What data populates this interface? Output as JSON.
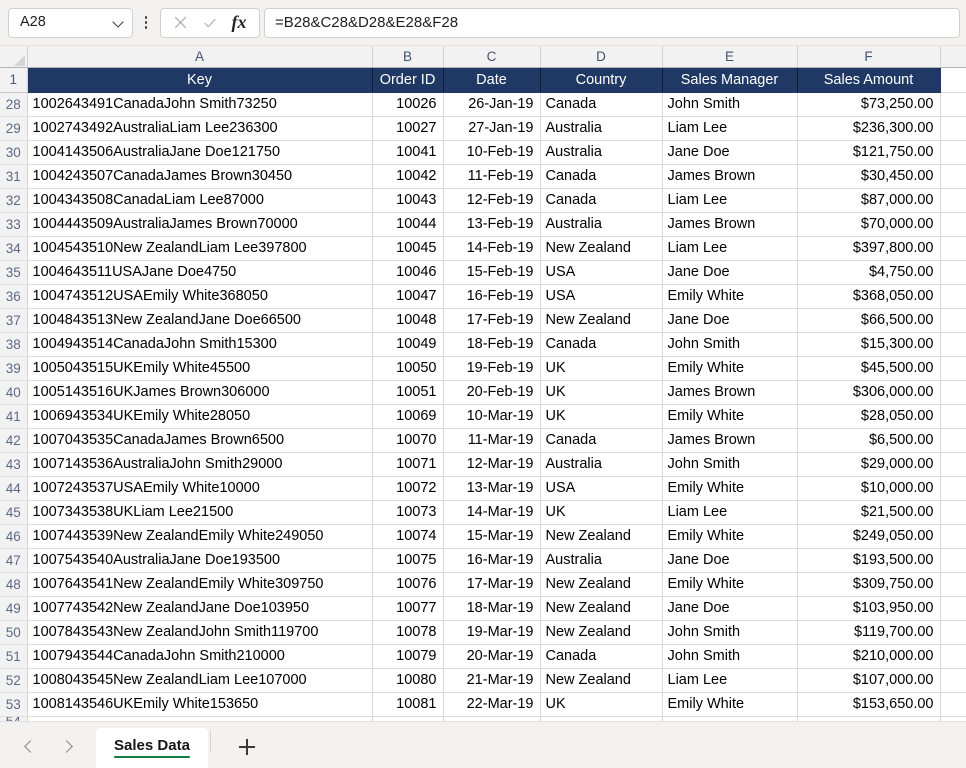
{
  "app": {
    "title": "Sales Data"
  },
  "formula_bar": {
    "name_box_value": "A28",
    "formula_value": "=B28&C28&D28&E28&F28",
    "cancel_label": "✕",
    "enter_label": "✓",
    "fx_label": "fx"
  },
  "grid": {
    "column_letters": [
      "A",
      "B",
      "C",
      "D",
      "E",
      "F",
      ""
    ],
    "header_row_number": "1",
    "headers": [
      "Key",
      "Order ID",
      "Date",
      "Country",
      "Sales Manager",
      "Sales Amount"
    ],
    "partial_row_number": "54",
    "rows": [
      {
        "n": "28",
        "key": "1002643491CanadaJohn Smith73250",
        "order_id": "10026",
        "date": "26-Jan-19",
        "country": "Canada",
        "manager": "John Smith",
        "amount": "$73,250.00"
      },
      {
        "n": "29",
        "key": "1002743492AustraliaLiam Lee236300",
        "order_id": "10027",
        "date": "27-Jan-19",
        "country": "Australia",
        "manager": "Liam Lee",
        "amount": "$236,300.00"
      },
      {
        "n": "30",
        "key": "1004143506AustraliaJane Doe121750",
        "order_id": "10041",
        "date": "10-Feb-19",
        "country": "Australia",
        "manager": "Jane Doe",
        "amount": "$121,750.00"
      },
      {
        "n": "31",
        "key": "1004243507CanadaJames Brown30450",
        "order_id": "10042",
        "date": "11-Feb-19",
        "country": "Canada",
        "manager": "James Brown",
        "amount": "$30,450.00"
      },
      {
        "n": "32",
        "key": "1004343508CanadaLiam Lee87000",
        "order_id": "10043",
        "date": "12-Feb-19",
        "country": "Canada",
        "manager": "Liam Lee",
        "amount": "$87,000.00"
      },
      {
        "n": "33",
        "key": "1004443509AustraliaJames Brown70000",
        "order_id": "10044",
        "date": "13-Feb-19",
        "country": "Australia",
        "manager": "James Brown",
        "amount": "$70,000.00"
      },
      {
        "n": "34",
        "key": "1004543510New ZealandLiam Lee397800",
        "order_id": "10045",
        "date": "14-Feb-19",
        "country": "New Zealand",
        "manager": "Liam Lee",
        "amount": "$397,800.00"
      },
      {
        "n": "35",
        "key": "1004643511USAJane Doe4750",
        "order_id": "10046",
        "date": "15-Feb-19",
        "country": "USA",
        "manager": "Jane Doe",
        "amount": "$4,750.00"
      },
      {
        "n": "36",
        "key": "1004743512USAEmily White368050",
        "order_id": "10047",
        "date": "16-Feb-19",
        "country": "USA",
        "manager": "Emily White",
        "amount": "$368,050.00"
      },
      {
        "n": "37",
        "key": "1004843513New ZealandJane Doe66500",
        "order_id": "10048",
        "date": "17-Feb-19",
        "country": "New Zealand",
        "manager": "Jane Doe",
        "amount": "$66,500.00"
      },
      {
        "n": "38",
        "key": "1004943514CanadaJohn Smith15300",
        "order_id": "10049",
        "date": "18-Feb-19",
        "country": "Canada",
        "manager": "John Smith",
        "amount": "$15,300.00"
      },
      {
        "n": "39",
        "key": "1005043515UKEmily White45500",
        "order_id": "10050",
        "date": "19-Feb-19",
        "country": "UK",
        "manager": "Emily White",
        "amount": "$45,500.00"
      },
      {
        "n": "40",
        "key": "1005143516UKJames Brown306000",
        "order_id": "10051",
        "date": "20-Feb-19",
        "country": "UK",
        "manager": "James Brown",
        "amount": "$306,000.00"
      },
      {
        "n": "41",
        "key": "1006943534UKEmily White28050",
        "order_id": "10069",
        "date": "10-Mar-19",
        "country": "UK",
        "manager": "Emily White",
        "amount": "$28,050.00"
      },
      {
        "n": "42",
        "key": "1007043535CanadaJames Brown6500",
        "order_id": "10070",
        "date": "11-Mar-19",
        "country": "Canada",
        "manager": "James Brown",
        "amount": "$6,500.00"
      },
      {
        "n": "43",
        "key": "1007143536AustraliaJohn Smith29000",
        "order_id": "10071",
        "date": "12-Mar-19",
        "country": "Australia",
        "manager": "John Smith",
        "amount": "$29,000.00"
      },
      {
        "n": "44",
        "key": "1007243537USAEmily White10000",
        "order_id": "10072",
        "date": "13-Mar-19",
        "country": "USA",
        "manager": "Emily White",
        "amount": "$10,000.00"
      },
      {
        "n": "45",
        "key": "1007343538UKLiam Lee21500",
        "order_id": "10073",
        "date": "14-Mar-19",
        "country": "UK",
        "manager": "Liam Lee",
        "amount": "$21,500.00"
      },
      {
        "n": "46",
        "key": "1007443539New ZealandEmily White249050",
        "order_id": "10074",
        "date": "15-Mar-19",
        "country": "New Zealand",
        "manager": "Emily White",
        "amount": "$249,050.00"
      },
      {
        "n": "47",
        "key": "1007543540AustraliaJane Doe193500",
        "order_id": "10075",
        "date": "16-Mar-19",
        "country": "Australia",
        "manager": "Jane Doe",
        "amount": "$193,500.00"
      },
      {
        "n": "48",
        "key": "1007643541New ZealandEmily White309750",
        "order_id": "10076",
        "date": "17-Mar-19",
        "country": "New Zealand",
        "manager": "Emily White",
        "amount": "$309,750.00"
      },
      {
        "n": "49",
        "key": "1007743542New ZealandJane Doe103950",
        "order_id": "10077",
        "date": "18-Mar-19",
        "country": "New Zealand",
        "manager": "Jane Doe",
        "amount": "$103,950.00"
      },
      {
        "n": "50",
        "key": "1007843543New ZealandJohn Smith119700",
        "order_id": "10078",
        "date": "19-Mar-19",
        "country": "New Zealand",
        "manager": "John Smith",
        "amount": "$119,700.00"
      },
      {
        "n": "51",
        "key": "1007943544CanadaJohn Smith210000",
        "order_id": "10079",
        "date": "20-Mar-19",
        "country": "Canada",
        "manager": "John Smith",
        "amount": "$210,000.00"
      },
      {
        "n": "52",
        "key": "1008043545New ZealandLiam Lee107000",
        "order_id": "10080",
        "date": "21-Mar-19",
        "country": "New Zealand",
        "manager": "Liam Lee",
        "amount": "$107,000.00"
      },
      {
        "n": "53",
        "key": "1008143546UKEmily White153650",
        "order_id": "10081",
        "date": "22-Mar-19",
        "country": "UK",
        "manager": "Emily White",
        "amount": "$153,650.00"
      }
    ]
  },
  "tabbar": {
    "sheets": [
      {
        "label": "Sales Data",
        "active": true
      }
    ],
    "add_sheet_label": "+"
  },
  "colors": {
    "header_navy": "#1F3864",
    "tab_accent_green": "#107C41",
    "rownum_text": "#5B6A85",
    "chrome_bg": "#F3F2F1"
  }
}
